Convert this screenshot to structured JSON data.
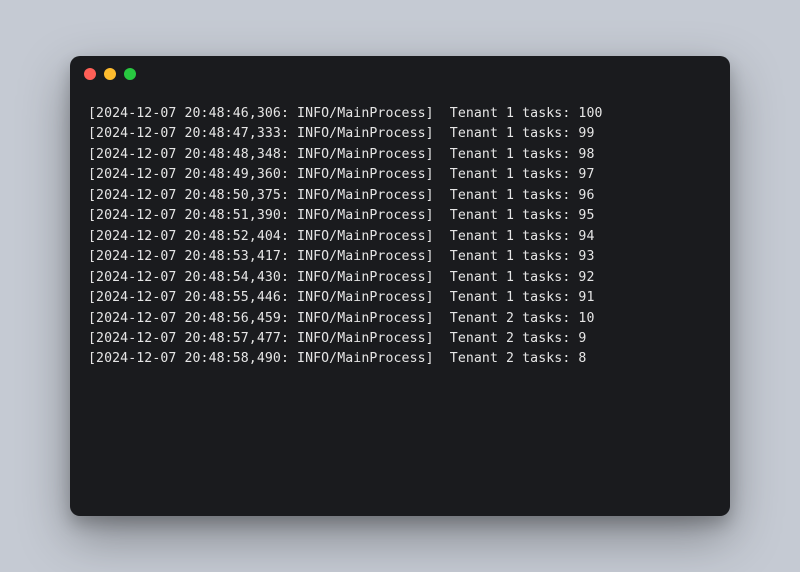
{
  "colors": {
    "background": "#c5cad3",
    "terminal_bg": "#1a1b1e",
    "text": "#e6e6e6",
    "dot_red": "#ff5f57",
    "dot_yellow": "#febc2e",
    "dot_green": "#28c840"
  },
  "log_format": {
    "level": "INFO",
    "process": "MainProcess",
    "date": "2024-12-07"
  },
  "logs": [
    {
      "timestamp": "2024-12-07 20:48:46,306",
      "level": "INFO",
      "process": "MainProcess",
      "tenant": 1,
      "tasks": 100
    },
    {
      "timestamp": "2024-12-07 20:48:47,333",
      "level": "INFO",
      "process": "MainProcess",
      "tenant": 1,
      "tasks": 99
    },
    {
      "timestamp": "2024-12-07 20:48:48,348",
      "level": "INFO",
      "process": "MainProcess",
      "tenant": 1,
      "tasks": 98
    },
    {
      "timestamp": "2024-12-07 20:48:49,360",
      "level": "INFO",
      "process": "MainProcess",
      "tenant": 1,
      "tasks": 97
    },
    {
      "timestamp": "2024-12-07 20:48:50,375",
      "level": "INFO",
      "process": "MainProcess",
      "tenant": 1,
      "tasks": 96
    },
    {
      "timestamp": "2024-12-07 20:48:51,390",
      "level": "INFO",
      "process": "MainProcess",
      "tenant": 1,
      "tasks": 95
    },
    {
      "timestamp": "2024-12-07 20:48:52,404",
      "level": "INFO",
      "process": "MainProcess",
      "tenant": 1,
      "tasks": 94
    },
    {
      "timestamp": "2024-12-07 20:48:53,417",
      "level": "INFO",
      "process": "MainProcess",
      "tenant": 1,
      "tasks": 93
    },
    {
      "timestamp": "2024-12-07 20:48:54,430",
      "level": "INFO",
      "process": "MainProcess",
      "tenant": 1,
      "tasks": 92
    },
    {
      "timestamp": "2024-12-07 20:48:55,446",
      "level": "INFO",
      "process": "MainProcess",
      "tenant": 1,
      "tasks": 91
    },
    {
      "timestamp": "2024-12-07 20:48:56,459",
      "level": "INFO",
      "process": "MainProcess",
      "tenant": 2,
      "tasks": 10
    },
    {
      "timestamp": "2024-12-07 20:48:57,477",
      "level": "INFO",
      "process": "MainProcess",
      "tenant": 2,
      "tasks": 9
    },
    {
      "timestamp": "2024-12-07 20:48:58,490",
      "level": "INFO",
      "process": "MainProcess",
      "tenant": 2,
      "tasks": 8
    }
  ]
}
